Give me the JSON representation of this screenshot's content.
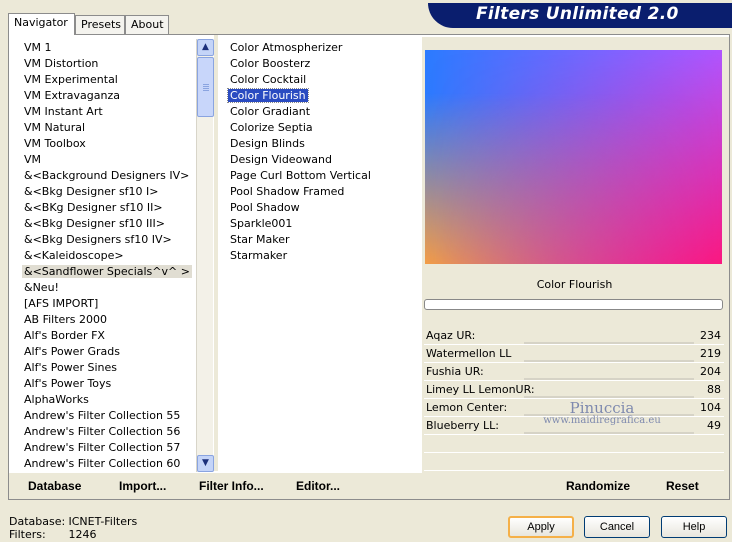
{
  "app": {
    "title": "Filters Unlimited 2.0"
  },
  "tabs": [
    {
      "label": "Navigator",
      "active": true
    },
    {
      "label": "Presets",
      "active": false
    },
    {
      "label": "About",
      "active": false
    }
  ],
  "categories": [
    "VM 1",
    "VM Distortion",
    "VM Experimental",
    "VM Extravaganza",
    "VM Instant Art",
    "VM Natural",
    "VM Toolbox",
    "VM",
    "&<Background Designers IV>",
    "&<Bkg Designer sf10 I>",
    "&<BKg Designer sf10 II>",
    "&<Bkg Designer sf10 III>",
    "&<Bkg Designers sf10 IV>",
    "&<Kaleidoscope>",
    "&<Sandflower Specials^v^ >",
    "&Neu!",
    "[AFS IMPORT]",
    "AB Filters 2000",
    "Alf's Border FX",
    "Alf's Power Grads",
    "Alf's Power Sines",
    "Alf's Power Toys",
    "AlphaWorks",
    "Andrew's Filter Collection 55",
    "Andrew's Filter Collection 56",
    "Andrew's Filter Collection 57",
    "Andrew's Filter Collection 60"
  ],
  "highlighted_category": "&<Sandflower Specials^v^ >",
  "filters": [
    "Color Atmospherizer",
    "Color Boosterz",
    "Color Cocktail",
    "Color Flourish",
    "Color Gradiant",
    "Colorize Septia",
    "Design Blinds",
    "Design Videowand",
    "Page Curl Bottom Vertical",
    "Pool Shadow Framed",
    "Pool Shadow",
    "Sparkle001",
    "Star Maker",
    "Starmaker"
  ],
  "selected_filter": "Color Flourish",
  "preview": {
    "filter_name": "Color Flourish",
    "colors": {
      "top_left": "#2b7bff",
      "top_right": "#b055ff",
      "bottom_left": "#ffa040",
      "bottom_right": "#ff1478"
    }
  },
  "progress": {
    "value": 0
  },
  "parameters": [
    {
      "label": "Aqaz UR:",
      "value": "234"
    },
    {
      "label": "Watermellon LL",
      "value": "219"
    },
    {
      "label": "Fushia UR:",
      "value": "204"
    },
    {
      "label": "Limey LL LemonUR:",
      "value": "88"
    },
    {
      "label": "Lemon Center:",
      "value": "104"
    },
    {
      "label": "Blueberry LL:",
      "value": "49"
    }
  ],
  "watermark": {
    "line1": "Pinuccia",
    "line2": "www.maidiregrafica.eu"
  },
  "bottom_links": {
    "database": "Database",
    "import": "Import...",
    "filter_info": "Filter Info...",
    "editor": "Editor...",
    "randomize": "Randomize",
    "reset": "Reset"
  },
  "status": {
    "database_label": "Database:",
    "database_value": "ICNET-Filters",
    "filters_label": "Filters:",
    "filters_value": "1246"
  },
  "buttons": {
    "apply": "Apply",
    "cancel": "Cancel",
    "help": "Help"
  }
}
